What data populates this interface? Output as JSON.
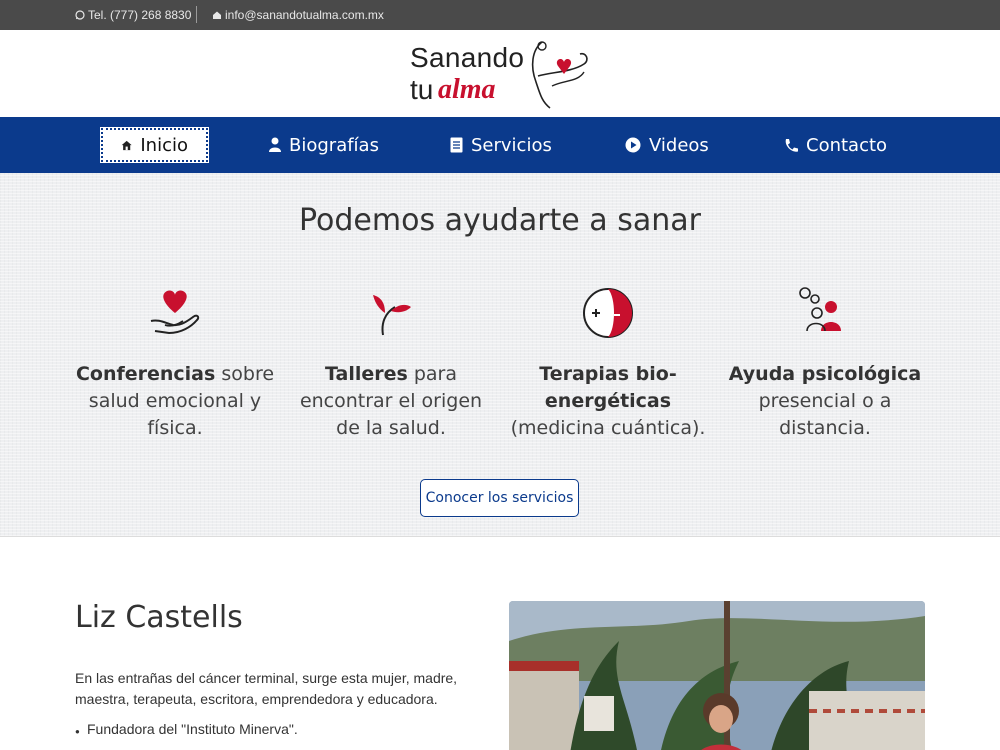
{
  "topbar": {
    "phone": "Tel. (777) 268 8830",
    "email": "info@sanandotualma.com.mx",
    "phone_icon": "whatsapp-icon",
    "email_icon": "home-mail-icon"
  },
  "logo": {
    "line1": "Sanando",
    "line2a": "tu",
    "line2b": "alma",
    "icon": "heart-figure-logo"
  },
  "nav": {
    "items": [
      {
        "label": "Inicio",
        "icon": "home-icon",
        "active": true
      },
      {
        "label": "Biografías",
        "icon": "user-icon",
        "active": false
      },
      {
        "label": "Servicios",
        "icon": "document-icon",
        "active": false
      },
      {
        "label": "Videos",
        "icon": "play-icon",
        "active": false
      },
      {
        "label": "Contacto",
        "icon": "phone-icon",
        "active": false
      }
    ]
  },
  "services": {
    "title": "Podemos ayudarte a sanar",
    "items": [
      {
        "bold": "Conferencias",
        "text": " sobre salud emocional y física.",
        "icon": "heart-hand-icon"
      },
      {
        "bold": "Talleres",
        "text": " para encontrar el origen de la salud.",
        "icon": "sprout-icon"
      },
      {
        "bold": "Terapias bio-energéticas",
        "text": " (medicina cuántica).",
        "icon": "plus-minus-circle-icon"
      },
      {
        "bold": "Ayuda psicológica",
        "text": " presencial o a distancia.",
        "icon": "people-chat-icon"
      }
    ],
    "cta": "Conocer los servicios"
  },
  "bio": {
    "name": "Liz Castells",
    "intro": "En las entrañas del cáncer terminal, surge esta mujer, madre, maestra, terapeuta, escritora, emprendedora y educadora.",
    "bullets": [
      "Fundadora del \"Instituto Minerva\"."
    ],
    "photo_alt": "photo-of-liz-castells"
  },
  "colors": {
    "nav_blue": "#0b3a8c",
    "accent_red": "#c8102e",
    "topbar": "#4a4a4a"
  }
}
